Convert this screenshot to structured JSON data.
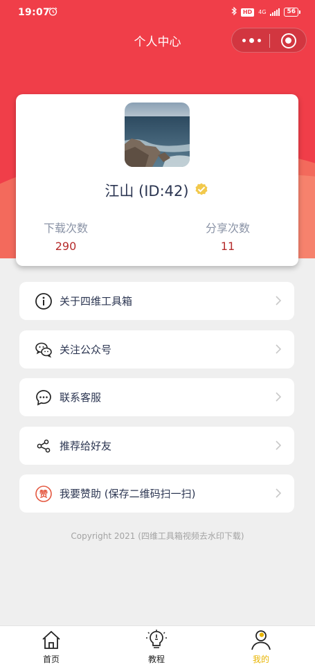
{
  "status_bar": {
    "time": "19:07",
    "alarm_icon": "alarm-clock-icon",
    "network": "4G",
    "hd_badge": "HD",
    "battery": "56"
  },
  "nav": {
    "title": "个人中心",
    "more_icon": "more-dots-icon",
    "close_icon": "target-close-icon"
  },
  "profile": {
    "username": "江山 (ID:42)",
    "verified_icon": "verified-badge-icon",
    "stats": [
      {
        "label": "下载次数",
        "value": "290"
      },
      {
        "label": "分享次数",
        "value": "11"
      }
    ]
  },
  "menu": [
    {
      "label": "关于四维工具箱",
      "icon": "info-icon"
    },
    {
      "label": "关注公众号",
      "icon": "wechat-icon"
    },
    {
      "label": "联系客服",
      "icon": "chat-bubble-icon"
    },
    {
      "label": "推荐给好友",
      "icon": "share-icon"
    },
    {
      "label": "我要赞助 (保存二维码扫一扫)",
      "icon": "sponsor-icon",
      "icon_text": "赞"
    }
  ],
  "copyright": "Copyright 2021 (四维工具箱视频去水印下载)",
  "tabbar": [
    {
      "label": "首页",
      "icon": "home-icon",
      "active": false
    },
    {
      "label": "教程",
      "icon": "lightbulb-icon",
      "active": false
    },
    {
      "label": "我的",
      "icon": "user-icon",
      "active": true
    }
  ],
  "colors": {
    "header": "#f03e49",
    "accent_active": "#e8b400",
    "stat_value": "#b52b2b"
  }
}
